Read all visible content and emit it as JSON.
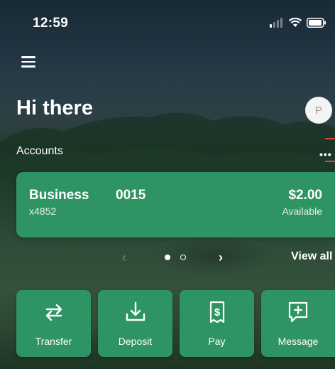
{
  "status_bar": {
    "time": "12:59"
  },
  "header": {
    "greeting": "Hi there",
    "avatar_initial": "P"
  },
  "accounts": {
    "label": "Accounts",
    "more_label": "•••",
    "cards": [
      {
        "name": "Business",
        "mask": "x4852",
        "number": "0015",
        "balance": "$2.00",
        "balance_label": "Available"
      }
    ],
    "pager": {
      "prev": "‹",
      "next": "›",
      "view_all": "View all"
    }
  },
  "actions": [
    {
      "label": "Transfer",
      "icon": "transfer-icon"
    },
    {
      "label": "Deposit",
      "icon": "deposit-icon"
    },
    {
      "label": "Pay",
      "icon": "pay-icon"
    },
    {
      "label": "Message",
      "icon": "message-icon"
    }
  ],
  "colors": {
    "card_green": "#2f9463",
    "accent_red": "#e0443c"
  }
}
